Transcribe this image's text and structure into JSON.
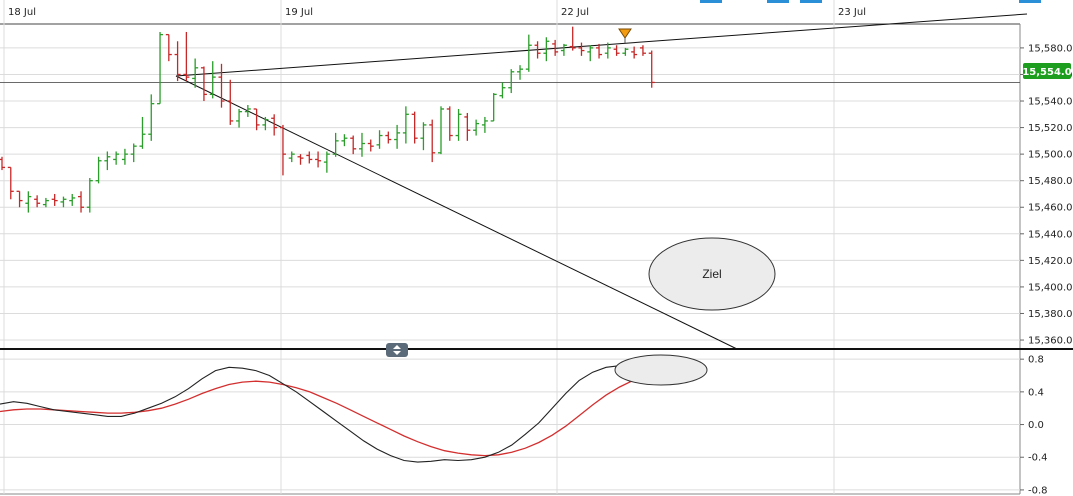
{
  "colors": {
    "up": "#2a9d2a",
    "down": "#c62828",
    "grid": "#dcdcdc",
    "line": "#111111",
    "signal": "#d32f2f",
    "macd": "#222222",
    "price_badge": "#1e9e1e",
    "marker": "#f39c12",
    "ellipse_fill": "#ececec",
    "top_tab": "#2b8fd8"
  },
  "icons": {
    "resize": "resize-handle-icon",
    "marker": "down-triangle-marker-icon"
  },
  "chart_data": [
    {
      "type": "bar",
      "subtype": "ohlc",
      "x_labels": [
        "18 Jul",
        "19 Jul",
        "22 Jul",
        "23 Jul"
      ],
      "y_ticks": [
        "15,580.0",
        "15,560.0",
        "15,540.0",
        "15,520.0",
        "15,500.0",
        "15,480.0",
        "15,460.0",
        "15,440.0",
        "15,420.0",
        "15,400.0",
        "15,380.0",
        "15,360.0"
      ],
      "ylim": [
        15354,
        15598
      ],
      "last_price": 15554.0,
      "last_price_label": "15,554.0",
      "grid": true,
      "annotation": "Ziel",
      "bars": [
        [
          15496,
          15498,
          15488,
          15490
        ],
        [
          15490,
          15490,
          15466,
          15472
        ],
        [
          15472,
          15472,
          15460,
          15465
        ],
        [
          15463,
          15472,
          15456,
          15468
        ],
        [
          15466,
          15469,
          15460,
          15463
        ],
        [
          15462,
          15467,
          15460,
          15465
        ],
        [
          15466,
          15470,
          15461,
          15465
        ],
        [
          15464,
          15468,
          15460,
          15466
        ],
        [
          15465,
          15470,
          15461,
          15467
        ],
        [
          15468,
          15472,
          15456,
          15460
        ],
        [
          15460,
          15482,
          15456,
          15480
        ],
        [
          15480,
          15498,
          15478,
          15495
        ],
        [
          15495,
          15502,
          15488,
          15498
        ],
        [
          15496,
          15502,
          15492,
          15500
        ],
        [
          15496,
          15504,
          15492,
          15500
        ],
        [
          15500,
          15508,
          15494,
          15506
        ],
        [
          15506,
          15528,
          15504,
          15515
        ],
        [
          15515,
          15545,
          15510,
          15538
        ],
        [
          15538,
          15592,
          15538,
          15590
        ],
        [
          15590,
          15590,
          15570,
          15575
        ],
        [
          15575,
          15585,
          15555,
          15560
        ],
        [
          15560,
          15592,
          15555,
          15558
        ],
        [
          15557,
          15572,
          15550,
          15565
        ],
        [
          15565,
          15566,
          15540,
          15545
        ],
        [
          15545,
          15570,
          15542,
          15558
        ],
        [
          15558,
          15568,
          15535,
          15540
        ],
        [
          15540,
          15556,
          15522,
          15525
        ],
        [
          15525,
          15534,
          15520,
          15532
        ],
        [
          15532,
          15537,
          15528,
          15534
        ],
        [
          15534,
          15534,
          15518,
          15522
        ],
        [
          15522,
          15528,
          15518,
          15526
        ],
        [
          15527,
          15530,
          15514,
          15520
        ],
        [
          15520,
          15522,
          15484,
          15500
        ],
        [
          15497,
          15502,
          15494,
          15500
        ],
        [
          15498,
          15500,
          15492,
          15497
        ],
        [
          15499,
          15502,
          15493,
          15496
        ],
        [
          15496,
          15502,
          15490,
          15495
        ],
        [
          15494,
          15502,
          15486,
          15500
        ],
        [
          15500,
          15516,
          15498,
          15510
        ],
        [
          15510,
          15515,
          15506,
          15512
        ],
        [
          15512,
          15514,
          15500,
          15504
        ],
        [
          15504,
          15516,
          15498,
          15508
        ],
        [
          15508,
          15511,
          15502,
          15506
        ],
        [
          15507,
          15518,
          15504,
          15514
        ],
        [
          15514,
          15517,
          15508,
          15511
        ],
        [
          15511,
          15522,
          15504,
          15516
        ],
        [
          15516,
          15536,
          15508,
          15530
        ],
        [
          15530,
          15532,
          15508,
          15512
        ],
        [
          15512,
          15524,
          15503,
          15522
        ],
        [
          15522,
          15526,
          15494,
          15501
        ],
        [
          15501,
          15536,
          15500,
          15534
        ],
        [
          15534,
          15536,
          15510,
          15514
        ],
        [
          15514,
          15534,
          15510,
          15530
        ],
        [
          15528,
          15531,
          15510,
          15518
        ],
        [
          15518,
          15526,
          15514,
          15523
        ],
        [
          15522,
          15528,
          15516,
          15525
        ],
        [
          15525,
          15546,
          15525,
          15545
        ],
        [
          15544,
          15554,
          15542,
          15550
        ],
        [
          15550,
          15564,
          15546,
          15562
        ],
        [
          15562,
          15567,
          15556,
          15564
        ],
        [
          15564,
          15590,
          15562,
          15582
        ],
        [
          15582,
          15585,
          15572,
          15576
        ],
        [
          15576,
          15588,
          15570,
          15585
        ],
        [
          15583,
          15586,
          15574,
          15577
        ],
        [
          15578,
          15583,
          15574,
          15582
        ],
        [
          15581,
          15596,
          15578,
          15580
        ],
        [
          15580,
          15584,
          15574,
          15578
        ],
        [
          15577,
          15582,
          15570,
          15580
        ],
        [
          15580,
          15583,
          15572,
          15575
        ],
        [
          15576,
          15584,
          15572,
          15580
        ],
        [
          15579,
          15582,
          15574,
          15576
        ],
        [
          15576,
          15580,
          15574,
          15579
        ],
        [
          15577,
          15581,
          15572,
          15575
        ],
        [
          15580,
          15582,
          15574,
          15576
        ],
        [
          15576,
          15578,
          15550,
          15554
        ]
      ]
    },
    {
      "type": "line",
      "y_ticks": [
        "0.8",
        "0.4",
        "0.0",
        "-0.4",
        "-0.8"
      ],
      "ylim": [
        -0.85,
        0.9
      ],
      "grid": true,
      "series": [
        {
          "values": [
            0.25,
            0.28,
            0.26,
            0.22,
            0.18,
            0.16,
            0.14,
            0.12,
            0.1,
            0.1,
            0.14,
            0.2,
            0.26,
            0.34,
            0.44,
            0.56,
            0.66,
            0.7,
            0.69,
            0.66,
            0.6,
            0.5,
            0.4,
            0.28,
            0.16,
            0.04,
            -0.08,
            -0.2,
            -0.3,
            -0.38,
            -0.44,
            -0.46,
            -0.45,
            -0.43,
            -0.44,
            -0.43,
            -0.4,
            -0.34,
            -0.25,
            -0.12,
            0.02,
            0.2,
            0.38,
            0.54,
            0.64,
            0.7,
            0.72,
            0.72,
            0.7,
            0.64
          ]
        },
        {
          "values": [
            0.16,
            0.18,
            0.19,
            0.19,
            0.18,
            0.17,
            0.16,
            0.15,
            0.14,
            0.14,
            0.15,
            0.17,
            0.2,
            0.25,
            0.31,
            0.38,
            0.44,
            0.49,
            0.52,
            0.53,
            0.52,
            0.49,
            0.45,
            0.4,
            0.33,
            0.26,
            0.18,
            0.1,
            0.02,
            -0.06,
            -0.14,
            -0.21,
            -0.27,
            -0.32,
            -0.35,
            -0.37,
            -0.38,
            -0.37,
            -0.34,
            -0.29,
            -0.22,
            -0.13,
            -0.02,
            0.11,
            0.24,
            0.36,
            0.46,
            0.54,
            0.59,
            0.6
          ]
        }
      ]
    }
  ]
}
